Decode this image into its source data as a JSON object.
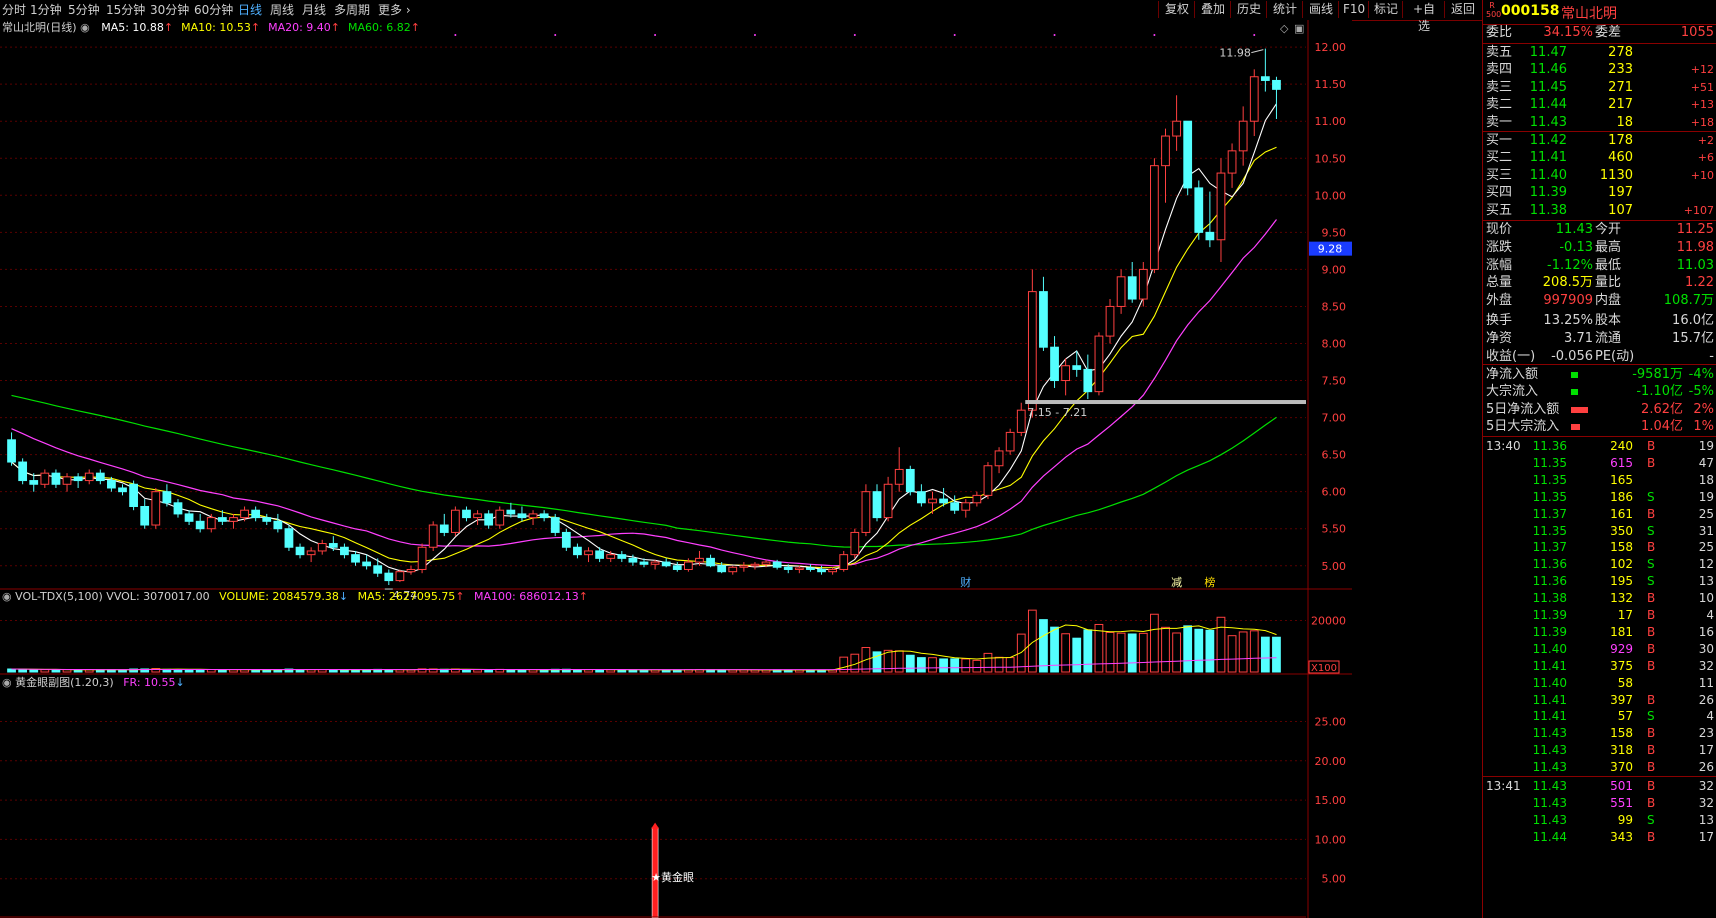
{
  "toolbar": {
    "periods": [
      "分时",
      "1分钟",
      "5分钟",
      "15分钟",
      "30分钟",
      "60分钟",
      "日线",
      "周线",
      "月线",
      "多周期",
      "更多"
    ],
    "active_period": "日线",
    "tools": [
      "复权",
      "叠加",
      "历史",
      "统计",
      "画线",
      "F10",
      "标记",
      "+自选",
      "返回"
    ]
  },
  "main_panel": {
    "title": "常山北明(日线)",
    "ma_legend": [
      {
        "label": "MA5: 10.88",
        "color": "#ffffff"
      },
      {
        "label": "MA10: 10.53",
        "color": "#ffff00"
      },
      {
        "label": "MA20: 9.40",
        "color": "#ff40ff"
      },
      {
        "label": "MA60: 6.82",
        "color": "#00e000"
      }
    ],
    "price_axis": [
      "12.00",
      "11.50",
      "11.00",
      "10.50",
      "10.00",
      "9.50",
      "9.00",
      "8.50",
      "8.00",
      "7.50",
      "7.00",
      "6.50",
      "6.00",
      "5.50",
      "5.00"
    ],
    "current_price_marker": "9.28",
    "annotations": {
      "high": "11.98",
      "low": "4.74",
      "range": "7.15 - 7.21"
    },
    "event_markers": [
      "财",
      "减",
      "榜"
    ]
  },
  "volume_panel": {
    "title": "VOL-TDX(5,100)",
    "vvol": "VVOL: 3070017.00",
    "volume": "VOLUME: 2084579.38",
    "ma5": "MA5: 2627095.75",
    "ma100": "MA100: 686012.13",
    "axis": [
      "20000"
    ],
    "unit": "X100"
  },
  "indicator_panel": {
    "title": "黄金眼副图(1.20,3)",
    "fr": "FR: 10.55",
    "axis": [
      "25.00",
      "20.00",
      "15.00",
      "10.00",
      "5.00"
    ],
    "signal_label": "★黄金眼"
  },
  "stock": {
    "badge": "R\n500",
    "code": "000158",
    "name": "常山北明"
  },
  "order_book": {
    "committee_ratio_label": "委比",
    "committee_ratio": "34.15%",
    "committee_diff_label": "委差",
    "committee_diff": "1055",
    "asks": [
      {
        "label": "卖五",
        "price": "11.47",
        "vol": "278",
        "chg": ""
      },
      {
        "label": "卖四",
        "price": "11.46",
        "vol": "233",
        "chg": "+12"
      },
      {
        "label": "卖三",
        "price": "11.45",
        "vol": "271",
        "chg": "+51"
      },
      {
        "label": "卖二",
        "price": "11.44",
        "vol": "217",
        "chg": "+13"
      },
      {
        "label": "卖一",
        "price": "11.43",
        "vol": "18",
        "chg": "+18"
      }
    ],
    "bids": [
      {
        "label": "买一",
        "price": "11.42",
        "vol": "178",
        "chg": "+2"
      },
      {
        "label": "买二",
        "price": "11.41",
        "vol": "460",
        "chg": "+6"
      },
      {
        "label": "买三",
        "price": "11.40",
        "vol": "1130",
        "chg": "+10"
      },
      {
        "label": "买四",
        "price": "11.39",
        "vol": "197",
        "chg": ""
      },
      {
        "label": "买五",
        "price": "11.38",
        "vol": "107",
        "chg": "+107"
      }
    ]
  },
  "quote": [
    {
      "l1": "现价",
      "v1": "11.43",
      "c1": "#00e000",
      "l2": "今开",
      "v2": "11.25",
      "c2": "#ff4040"
    },
    {
      "l1": "涨跌",
      "v1": "-0.13",
      "c1": "#00e000",
      "l2": "最高",
      "v2": "11.98",
      "c2": "#ff4040"
    },
    {
      "l1": "涨幅",
      "v1": "-1.12%",
      "c1": "#00e000",
      "l2": "最低",
      "v2": "11.03",
      "c2": "#00e000"
    },
    {
      "l1": "总量",
      "v1": "208.5万",
      "c1": "#ffff00",
      "l2": "量比",
      "v2": "1.22",
      "c2": "#ff4040"
    },
    {
      "l1": "外盘",
      "v1": "997909",
      "c1": "#ff4040",
      "l2": "内盘",
      "v2": "108.7万",
      "c2": "#00e000"
    },
    {
      "l1": "换手",
      "v1": "13.25%",
      "c1": "#d8d8d8",
      "l2": "股本",
      "v2": "16.0亿",
      "c2": "#d8d8d8"
    },
    {
      "l1": "净资",
      "v1": "3.71",
      "c1": "#d8d8d8",
      "l2": "流通",
      "v2": "15.7亿",
      "c2": "#d8d8d8"
    },
    {
      "l1": "收益(一)",
      "v1": "-0.056",
      "c1": "#d8d8d8",
      "l2": "PE(动)",
      "v2": "-",
      "c2": "#d8d8d8"
    }
  ],
  "fund_flow": [
    {
      "label": "净流入额",
      "value": "-9581万",
      "pct": "-4%",
      "color": "#00e000",
      "bar": 0.08
    },
    {
      "label": "大宗流入",
      "value": "-1.10亿",
      "pct": "-5%",
      "color": "#00e000",
      "bar": 0.08
    },
    {
      "label": "5日净流入额",
      "value": "2.62亿",
      "pct": "2%",
      "color": "#ff4040",
      "bar": 0.6
    },
    {
      "label": "5日大宗流入",
      "value": "1.04亿",
      "pct": "1%",
      "color": "#ff4040",
      "bar": 0.15
    }
  ],
  "ticks": [
    {
      "time": "13:40",
      "price": "11.36",
      "vol": "240",
      "side": "B",
      "n": "19",
      "pc": "#00e000",
      "vc": "#ffff00"
    },
    {
      "time": "",
      "price": "11.35",
      "vol": "615",
      "side": "B",
      "n": "47",
      "pc": "#00e000",
      "vc": "#ff40ff"
    },
    {
      "time": "",
      "price": "11.35",
      "vol": "165",
      "side": "",
      "n": "18",
      "pc": "#00e000",
      "vc": "#ffff00"
    },
    {
      "time": "",
      "price": "11.35",
      "vol": "186",
      "side": "S",
      "n": "19",
      "pc": "#00e000",
      "vc": "#ffff00"
    },
    {
      "time": "",
      "price": "11.37",
      "vol": "161",
      "side": "B",
      "n": "25",
      "pc": "#00e000",
      "vc": "#ffff00"
    },
    {
      "time": "",
      "price": "11.35",
      "vol": "350",
      "side": "S",
      "n": "31",
      "pc": "#00e000",
      "vc": "#ffff00"
    },
    {
      "time": "",
      "price": "11.37",
      "vol": "158",
      "side": "B",
      "n": "25",
      "pc": "#00e000",
      "vc": "#ffff00"
    },
    {
      "time": "",
      "price": "11.36",
      "vol": "102",
      "side": "S",
      "n": "12",
      "pc": "#00e000",
      "vc": "#ffff00"
    },
    {
      "time": "",
      "price": "11.36",
      "vol": "195",
      "side": "S",
      "n": "13",
      "pc": "#00e000",
      "vc": "#ffff00"
    },
    {
      "time": "",
      "price": "11.38",
      "vol": "132",
      "side": "B",
      "n": "10",
      "pc": "#00e000",
      "vc": "#ffff00"
    },
    {
      "time": "",
      "price": "11.39",
      "vol": "17",
      "side": "B",
      "n": "4",
      "pc": "#00e000",
      "vc": "#ffff00"
    },
    {
      "time": "",
      "price": "11.39",
      "vol": "181",
      "side": "B",
      "n": "16",
      "pc": "#00e000",
      "vc": "#ffff00"
    },
    {
      "time": "",
      "price": "11.40",
      "vol": "929",
      "side": "B",
      "n": "30",
      "pc": "#00e000",
      "vc": "#ff40ff"
    },
    {
      "time": "",
      "price": "11.41",
      "vol": "375",
      "side": "B",
      "n": "32",
      "pc": "#00e000",
      "vc": "#ffff00"
    },
    {
      "time": "",
      "price": "11.40",
      "vol": "58",
      "side": "",
      "n": "11",
      "pc": "#00e000",
      "vc": "#ffff00"
    },
    {
      "time": "",
      "price": "11.41",
      "vol": "397",
      "side": "B",
      "n": "26",
      "pc": "#00e000",
      "vc": "#ffff00"
    },
    {
      "time": "",
      "price": "11.41",
      "vol": "57",
      "side": "S",
      "n": "4",
      "pc": "#00e000",
      "vc": "#ffff00"
    },
    {
      "time": "",
      "price": "11.43",
      "vol": "158",
      "side": "B",
      "n": "23",
      "pc": "#00e000",
      "vc": "#ffff00"
    },
    {
      "time": "",
      "price": "11.43",
      "vol": "318",
      "side": "B",
      "n": "17",
      "pc": "#00e000",
      "vc": "#ffff00"
    },
    {
      "time": "",
      "price": "11.43",
      "vol": "370",
      "side": "B",
      "n": "26",
      "pc": "#00e000",
      "vc": "#ffff00"
    },
    {
      "time": "13:41",
      "price": "11.43",
      "vol": "501",
      "side": "B",
      "n": "32",
      "pc": "#00e000",
      "vc": "#ff40ff"
    },
    {
      "time": "",
      "price": "11.43",
      "vol": "551",
      "side": "B",
      "n": "32",
      "pc": "#00e000",
      "vc": "#ff40ff"
    },
    {
      "time": "",
      "price": "11.43",
      "vol": "99",
      "side": "S",
      "n": "13",
      "pc": "#00e000",
      "vc": "#ffff00"
    },
    {
      "time": "",
      "price": "11.44",
      "vol": "343",
      "side": "B",
      "n": "17",
      "pc": "#00e000",
      "vc": "#ffff00"
    }
  ],
  "chart_data": {
    "type": "candlestick",
    "series_note": "daily OHLC (approximate), oldest to newest",
    "candles": [
      [
        6.7,
        6.8,
        6.35,
        6.4
      ],
      [
        6.4,
        6.45,
        6.1,
        6.15
      ],
      [
        6.15,
        6.25,
        6.0,
        6.1
      ],
      [
        6.1,
        6.3,
        6.05,
        6.25
      ],
      [
        6.25,
        6.3,
        6.05,
        6.1
      ],
      [
        6.1,
        6.25,
        6.0,
        6.2
      ],
      [
        6.2,
        6.25,
        6.05,
        6.15
      ],
      [
        6.15,
        6.3,
        6.1,
        6.25
      ],
      [
        6.25,
        6.3,
        6.1,
        6.15
      ],
      [
        6.15,
        6.2,
        6.0,
        6.05
      ],
      [
        6.05,
        6.1,
        5.95,
        6.0
      ],
      [
        6.1,
        6.15,
        5.75,
        5.8
      ],
      [
        5.8,
        5.9,
        5.5,
        5.55
      ],
      [
        5.55,
        6.05,
        5.5,
        6.0
      ],
      [
        6.0,
        6.1,
        5.8,
        5.85
      ],
      [
        5.85,
        5.9,
        5.65,
        5.7
      ],
      [
        5.7,
        5.75,
        5.55,
        5.6
      ],
      [
        5.6,
        5.7,
        5.45,
        5.5
      ],
      [
        5.5,
        5.7,
        5.45,
        5.65
      ],
      [
        5.65,
        5.75,
        5.55,
        5.6
      ],
      [
        5.6,
        5.7,
        5.5,
        5.65
      ],
      [
        5.65,
        5.8,
        5.6,
        5.75
      ],
      [
        5.75,
        5.8,
        5.6,
        5.65
      ],
      [
        5.65,
        5.7,
        5.55,
        5.6
      ],
      [
        5.6,
        5.7,
        5.45,
        5.5
      ],
      [
        5.5,
        5.55,
        5.2,
        5.25
      ],
      [
        5.25,
        5.3,
        5.1,
        5.15
      ],
      [
        5.15,
        5.25,
        5.05,
        5.2
      ],
      [
        5.2,
        5.35,
        5.15,
        5.3
      ],
      [
        5.3,
        5.4,
        5.2,
        5.25
      ],
      [
        5.25,
        5.3,
        5.1,
        5.15
      ],
      [
        5.15,
        5.2,
        5.0,
        5.05
      ],
      [
        5.05,
        5.15,
        4.95,
        5.0
      ],
      [
        5.0,
        5.1,
        4.85,
        4.9
      ],
      [
        4.9,
        4.95,
        4.74,
        4.8
      ],
      [
        4.8,
        4.95,
        4.78,
        4.92
      ],
      [
        4.92,
        5.0,
        4.88,
        4.95
      ],
      [
        4.95,
        5.3,
        4.9,
        5.25
      ],
      [
        5.25,
        5.6,
        5.2,
        5.55
      ],
      [
        5.55,
        5.7,
        5.4,
        5.45
      ],
      [
        5.45,
        5.8,
        5.4,
        5.75
      ],
      [
        5.75,
        5.8,
        5.6,
        5.65
      ],
      [
        5.65,
        5.75,
        5.55,
        5.7
      ],
      [
        5.7,
        5.75,
        5.5,
        5.55
      ],
      [
        5.55,
        5.8,
        5.5,
        5.75
      ],
      [
        5.75,
        5.85,
        5.65,
        5.7
      ],
      [
        5.7,
        5.8,
        5.6,
        5.65
      ],
      [
        5.65,
        5.75,
        5.55,
        5.7
      ],
      [
        5.7,
        5.75,
        5.6,
        5.65
      ],
      [
        5.65,
        5.7,
        5.4,
        5.45
      ],
      [
        5.45,
        5.5,
        5.2,
        5.25
      ],
      [
        5.25,
        5.3,
        5.1,
        5.15
      ],
      [
        5.15,
        5.25,
        5.05,
        5.2
      ],
      [
        5.2,
        5.25,
        5.05,
        5.1
      ],
      [
        5.1,
        5.2,
        5.05,
        5.15
      ],
      [
        5.15,
        5.2,
        5.05,
        5.1
      ],
      [
        5.1,
        5.15,
        5.0,
        5.05
      ],
      [
        5.05,
        5.1,
        4.98,
        5.02
      ],
      [
        5.02,
        5.08,
        4.95,
        5.05
      ],
      [
        5.05,
        5.1,
        4.98,
        5.0
      ],
      [
        5.0,
        5.05,
        4.92,
        4.95
      ],
      [
        4.95,
        5.1,
        4.92,
        5.05
      ],
      [
        5.05,
        5.2,
        5.0,
        5.1
      ],
      [
        5.1,
        5.15,
        4.98,
        5.0
      ],
      [
        5.0,
        5.05,
        4.9,
        4.92
      ],
      [
        4.92,
        5.0,
        4.88,
        4.98
      ],
      [
        4.98,
        5.05,
        4.92,
        5.0
      ],
      [
        5.0,
        5.05,
        4.95,
        5.02
      ],
      [
        5.02,
        5.08,
        4.98,
        5.05
      ],
      [
        5.05,
        5.08,
        4.95,
        4.98
      ],
      [
        4.98,
        5.02,
        4.9,
        4.95
      ],
      [
        4.95,
        5.0,
        4.9,
        4.97
      ],
      [
        4.97,
        5.02,
        4.92,
        4.95
      ],
      [
        4.95,
        5.0,
        4.88,
        4.92
      ],
      [
        4.92,
        4.98,
        4.88,
        4.95
      ],
      [
        4.95,
        5.2,
        4.92,
        5.15
      ],
      [
        5.15,
        5.5,
        5.1,
        5.45
      ],
      [
        5.45,
        6.1,
        5.4,
        6.0
      ],
      [
        6.0,
        6.1,
        5.6,
        5.65
      ],
      [
        5.65,
        6.2,
        5.6,
        6.1
      ],
      [
        6.1,
        6.6,
        6.0,
        6.3
      ],
      [
        6.3,
        6.35,
        5.95,
        6.0
      ],
      [
        6.0,
        6.1,
        5.8,
        5.85
      ],
      [
        5.85,
        6.0,
        5.7,
        5.9
      ],
      [
        5.9,
        6.05,
        5.8,
        5.85
      ],
      [
        5.85,
        5.95,
        5.7,
        5.75
      ],
      [
        5.75,
        5.9,
        5.65,
        5.85
      ],
      [
        5.85,
        6.0,
        5.8,
        5.95
      ],
      [
        5.95,
        6.4,
        5.9,
        6.35
      ],
      [
        6.35,
        6.6,
        6.25,
        6.55
      ],
      [
        6.55,
        6.85,
        6.5,
        6.8
      ],
      [
        6.8,
        7.2,
        6.75,
        7.1
      ],
      [
        7.1,
        9.0,
        7.0,
        8.7
      ],
      [
        8.7,
        8.9,
        7.9,
        7.95
      ],
      [
        7.95,
        8.1,
        7.4,
        7.5
      ],
      [
        7.5,
        7.8,
        7.3,
        7.7
      ],
      [
        7.7,
        7.9,
        7.55,
        7.65
      ],
      [
        7.65,
        7.85,
        7.25,
        7.35
      ],
      [
        7.35,
        8.15,
        7.3,
        8.1
      ],
      [
        8.1,
        8.6,
        8.0,
        8.5
      ],
      [
        8.5,
        9.0,
        8.4,
        8.9
      ],
      [
        8.9,
        9.1,
        8.55,
        8.6
      ],
      [
        8.6,
        9.1,
        8.5,
        9.0
      ],
      [
        9.0,
        10.5,
        8.95,
        10.4
      ],
      [
        10.4,
        10.9,
        9.9,
        10.8
      ],
      [
        10.8,
        11.35,
        10.6,
        11.0
      ],
      [
        11.0,
        11.0,
        10.0,
        10.1
      ],
      [
        10.1,
        10.2,
        9.4,
        9.5
      ],
      [
        9.5,
        10.05,
        9.3,
        9.4
      ],
      [
        9.4,
        10.5,
        9.1,
        10.3
      ],
      [
        10.3,
        10.7,
        10.1,
        10.6
      ],
      [
        10.6,
        11.2,
        10.4,
        11.0
      ],
      [
        11.0,
        11.7,
        10.8,
        11.6
      ],
      [
        11.6,
        11.98,
        11.4,
        11.55
      ],
      [
        11.55,
        11.6,
        11.03,
        11.43
      ]
    ],
    "price_range": [
      4.7,
      12.15
    ]
  }
}
